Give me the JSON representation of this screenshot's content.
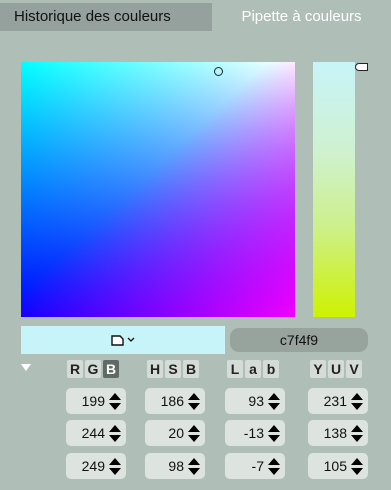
{
  "tabs": {
    "history_label": "Historique des couleurs",
    "picker_label": "Pipette à couleurs"
  },
  "current_color": {
    "hex": "c7f4f9",
    "swatch_color": "#c7f4f9"
  },
  "groups": [
    {
      "letters": [
        "R",
        "G",
        "B"
      ],
      "values": [
        "199",
        "244",
        "249"
      ]
    },
    {
      "letters": [
        "H",
        "S",
        "B"
      ],
      "values": [
        "186",
        "20",
        "98"
      ]
    },
    {
      "letters": [
        "L",
        "a",
        "b"
      ],
      "values": [
        "93",
        "-13",
        "-7"
      ]
    },
    {
      "letters": [
        "Y",
        "U",
        "V"
      ],
      "values": [
        "231",
        "138",
        "105"
      ]
    }
  ],
  "icons": {
    "swatch_menu": "document-dropdown-icon",
    "collapse": "triangle-down-icon"
  }
}
